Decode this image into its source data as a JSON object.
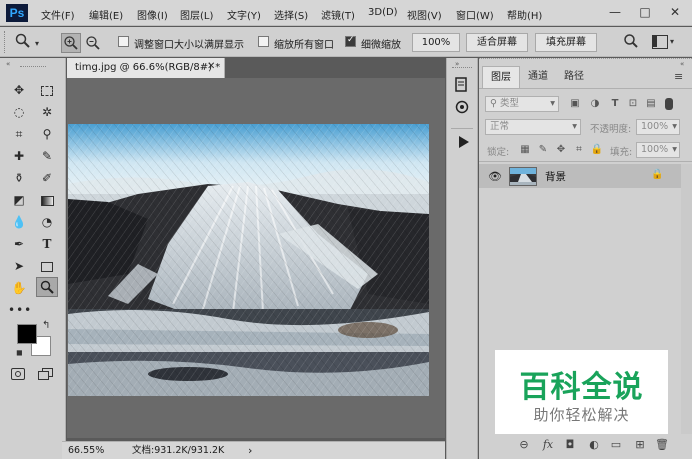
{
  "app": {
    "logo": "Ps"
  },
  "menu": [
    "文件(F)",
    "编辑(E)",
    "图像(I)",
    "图层(L)",
    "文字(Y)",
    "选择(S)",
    "滤镜(T)",
    "3D(D)",
    "视图(V)",
    "窗口(W)",
    "帮助(H)"
  ],
  "window_controls": {
    "minimize": "—",
    "maximize": "□",
    "close": "✕"
  },
  "options": {
    "resize_windows_label": "调整窗口大小以满屏显示",
    "resize_windows_checked": false,
    "zoom_all_label": "缩放所有窗口",
    "zoom_all_checked": false,
    "scrubby_zoom_label": "细微缩放",
    "scrubby_zoom_checked": true,
    "zoom_100_label": "100%",
    "fit_screen_label": "适合屏幕",
    "fill_screen_label": "填充屏幕"
  },
  "document": {
    "tab_title": "timg.jpg @ 66.6%(RGB/8#) *",
    "zoom": "66.55%",
    "doc_size": "文档:931.2K/931.2K",
    "status_arrow": "›"
  },
  "layers_panel": {
    "tabs": [
      "图层",
      "通道",
      "路径"
    ],
    "filter_kind": "类型",
    "blend_mode": "正常",
    "opacity_label": "不透明度:",
    "opacity_value": "100%",
    "lock_label": "锁定:",
    "fill_label": "填充:",
    "fill_value": "100%",
    "layer_name": "背景"
  },
  "watermark": {
    "title": "百科全说",
    "subtitle": "助你轻松解决",
    "title_color": "#19a35a"
  },
  "colors": {
    "foreground": "#000000",
    "background": "#ffffff",
    "accent": "#31a8ff"
  }
}
